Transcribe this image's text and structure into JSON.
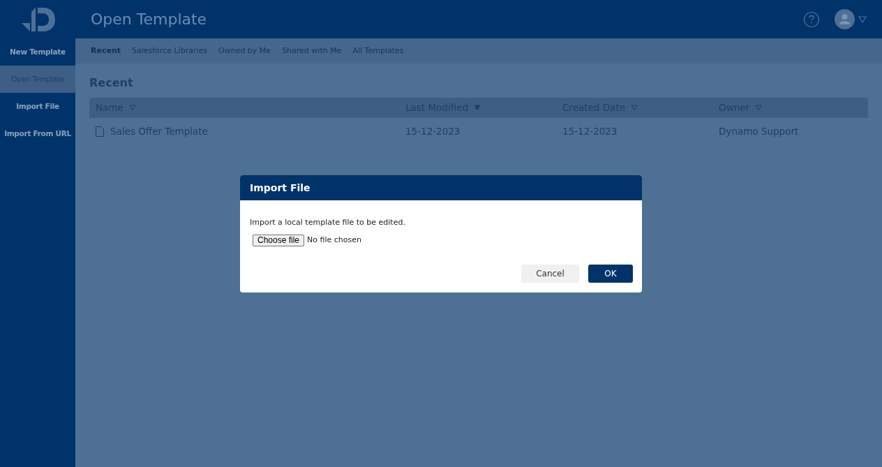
{
  "header": {
    "title": "Open Template"
  },
  "sidebar": {
    "items": [
      {
        "label": "New Template",
        "selected": false
      },
      {
        "label": "Open Template",
        "selected": true
      },
      {
        "label": "Import File",
        "selected": false
      },
      {
        "label": "Import From URL",
        "selected": false
      }
    ]
  },
  "tabs": [
    {
      "label": "Recent",
      "selected": true
    },
    {
      "label": "Salesforce Libraries",
      "selected": false
    },
    {
      "label": "Owned by Me",
      "selected": false
    },
    {
      "label": "Shared with Me",
      "selected": false
    },
    {
      "label": "All Templates",
      "selected": false
    }
  ],
  "section_title": "Recent",
  "table": {
    "columns": [
      {
        "label": "Name",
        "sorted": false
      },
      {
        "label": "Last Modified",
        "sorted": true
      },
      {
        "label": "Created Date",
        "sorted": false
      },
      {
        "label": "Owner",
        "sorted": false
      }
    ],
    "rows": [
      [
        "Sales Offer Template",
        "15-12-2023",
        "15-12-2023",
        "Dynamo Support"
      ]
    ]
  },
  "dialog": {
    "title": "Import File",
    "message": "Import a local template file to be edited.",
    "file_button": "Choose file",
    "file_status": "No file chosen",
    "buttons": [
      {
        "label": "Cancel",
        "kind": "secondary"
      },
      {
        "label": "OK",
        "kind": "primary"
      }
    ]
  }
}
